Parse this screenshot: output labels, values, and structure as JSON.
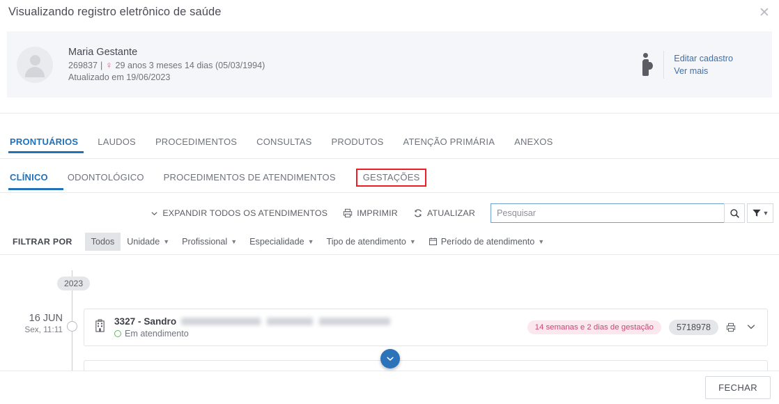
{
  "modal": {
    "title": "Visualizando registro eletrônico de saúde",
    "close_icon": "close-icon",
    "footer_button": "FECHAR"
  },
  "patient": {
    "avatar_icon": "person-avatar-icon",
    "name": "Maria Gestante",
    "record_number": "269837",
    "separator": "|",
    "sex_symbol": "♀",
    "age_line": "29 anos 3 meses 14 dias (05/03/1994)",
    "updated": "Atualizado em 19/06/2023",
    "pregnant_icon": "pregnant-woman-icon",
    "links": [
      {
        "label": "Editar cadastro",
        "name": "edit-registration-link"
      },
      {
        "label": "Ver mais",
        "name": "see-more-link"
      }
    ]
  },
  "tabs_primary": [
    {
      "label": "PRONTUÁRIOS",
      "active": true
    },
    {
      "label": "LAUDOS",
      "active": false
    },
    {
      "label": "PROCEDIMENTOS",
      "active": false
    },
    {
      "label": "CONSULTAS",
      "active": false
    },
    {
      "label": "PRODUTOS",
      "active": false
    },
    {
      "label": "ATENÇÃO PRIMÁRIA",
      "active": false
    },
    {
      "label": "ANEXOS",
      "active": false
    }
  ],
  "tabs_secondary": [
    {
      "label": "CLÍNICO",
      "active": true,
      "highlighted": false
    },
    {
      "label": "ODONTOLÓGICO",
      "active": false,
      "highlighted": false
    },
    {
      "label": "PROCEDIMENTOS DE ATENDIMENTOS",
      "active": false,
      "highlighted": false
    },
    {
      "label": "GESTAÇÕES",
      "active": false,
      "highlighted": true
    }
  ],
  "toolbar": {
    "expand_all": "EXPANDIR TODOS OS ATENDIMENTOS",
    "expand_icon": "chevron-down-icon",
    "print": "IMPRIMIR",
    "print_icon": "printer-icon",
    "refresh": "ATUALIZAR",
    "refresh_icon": "refresh-icon",
    "search_placeholder": "Pesquisar",
    "search_value": "",
    "search_icon": "search-icon",
    "filter_icon": "funnel-icon"
  },
  "filters": {
    "label": "FILTRAR POR",
    "chips": [
      {
        "label": "Todos",
        "selected": true,
        "caret": false,
        "icon": ""
      },
      {
        "label": "Unidade",
        "selected": false,
        "caret": true,
        "icon": ""
      },
      {
        "label": "Profissional",
        "selected": false,
        "caret": true,
        "icon": ""
      },
      {
        "label": "Especialidade",
        "selected": false,
        "caret": true,
        "icon": ""
      },
      {
        "label": "Tipo de atendimento",
        "selected": false,
        "caret": true,
        "icon": ""
      },
      {
        "label": "Período de atendimento",
        "selected": false,
        "caret": true,
        "icon": "calendar-icon"
      }
    ]
  },
  "timeline": {
    "year": "2023",
    "entry": {
      "date_day": "16 JUN",
      "date_time": "Sex, 11:11",
      "facility_icon": "hospital-building-icon",
      "title": "3327 - Sandro",
      "title_redacted": true,
      "status": "Em atendimento",
      "status_color": "#5cb85c",
      "gestation_badge": "14 semanas e 2 dias de gestação",
      "gestation_badge_color": "#c34a74",
      "id_badge": "5718978",
      "print_icon": "printer-icon",
      "expand_icon": "chevron-down-icon"
    },
    "scroll_fab_icon": "chevron-down-icon"
  },
  "colors": {
    "accent_blue": "#2272b9",
    "fab_blue": "#2d73ba",
    "highlight_red": "#ee1c25",
    "pink": "#e05a8a",
    "green": "#5cb85c",
    "panel_gray": "#f4f6f9"
  }
}
